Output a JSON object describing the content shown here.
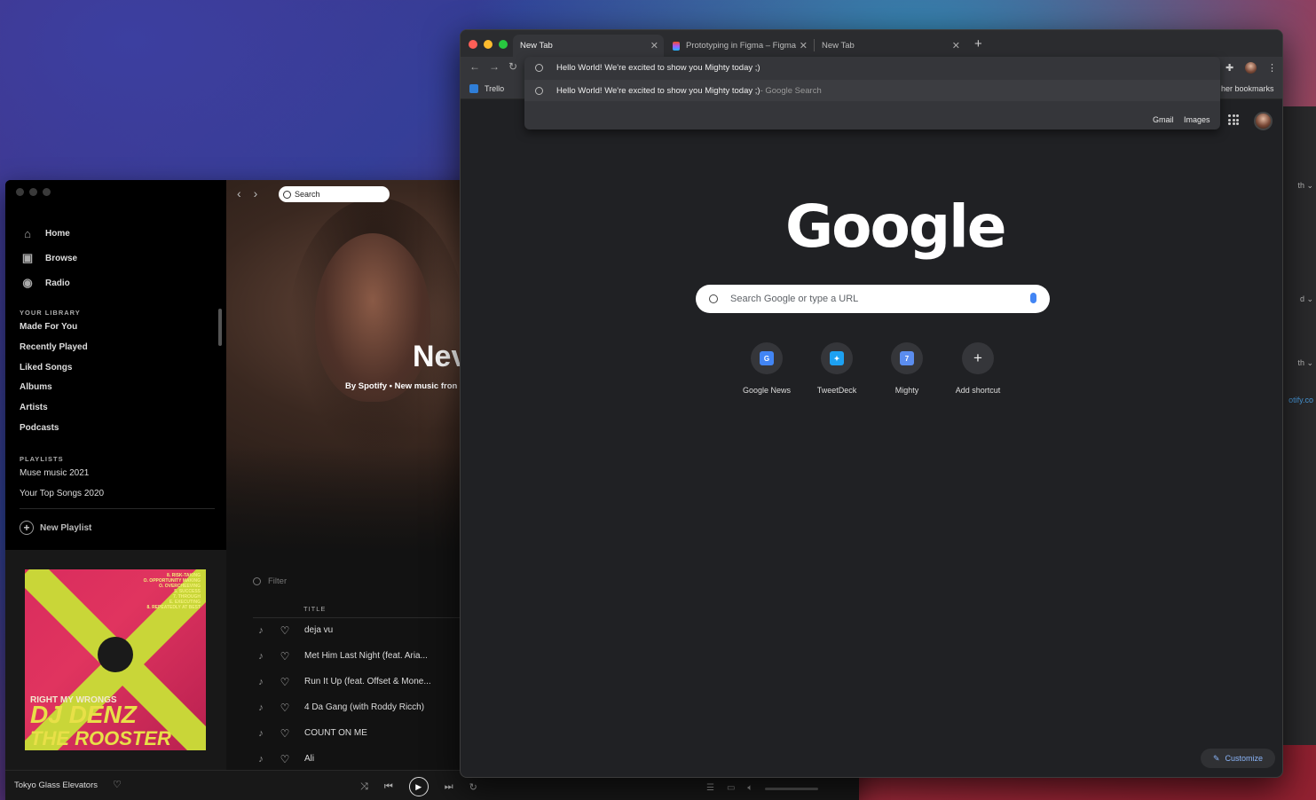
{
  "spotify": {
    "search_placeholder": "Search",
    "nav": [
      {
        "label": "Home",
        "icon": "home-icon",
        "glyph": "⌂"
      },
      {
        "label": "Browse",
        "icon": "browse-icon",
        "glyph": "▣"
      },
      {
        "label": "Radio",
        "icon": "radio-icon",
        "glyph": "◉"
      }
    ],
    "library_heading": "YOUR LIBRARY",
    "library": [
      "Made For You",
      "Recently Played",
      "Liked Songs",
      "Albums",
      "Artists",
      "Podcasts"
    ],
    "playlists_heading": "PLAYLISTS",
    "playlists": [
      "Muse music 2021",
      "Your Top Songs 2020"
    ],
    "new_playlist": "New Playlist",
    "album": {
      "list_lines": [
        "8. RISK-TAKING",
        "O. OPPORTUNITY MAKING",
        "O. OVERCHEEVING",
        "5. SUCCESS",
        "7. THROUGH",
        "E. EXECUTING",
        "8. REPEATEDLY AT BEST"
      ],
      "line1": "RIGHT MY WRONGS",
      "line2": "DJ DENZ",
      "line3": "THE ROOSTER"
    },
    "hero": {
      "title": "Nev",
      "subtitle": "By Spotify • New music fron"
    },
    "filter_placeholder": "Filter",
    "col_title": "TITLE",
    "tracks": [
      "deja vu",
      "Met Him Last Night (feat. Aria...",
      "Run It Up (feat. Offset & Mone...",
      "4 Da Gang (with Roddy Ricch)",
      "COUNT ON ME",
      "Ali"
    ],
    "now_playing": "Tokyo Glass Elevators"
  },
  "chrome": {
    "tabs": [
      {
        "label": "New Tab",
        "active": true
      },
      {
        "label": "Prototyping in Figma – Figma",
        "active": false
      },
      {
        "label": "New Tab",
        "active": false
      }
    ],
    "omnibox": {
      "input": "Hello World! We're excited to show you Mighty today ;)",
      "suggestion": "Hello World! We're excited to show you Mighty today ;)",
      "suggestion_hint": " - Google Search"
    },
    "bookmarks": {
      "trello": "Trello",
      "other": "her bookmarks"
    },
    "gbar": {
      "gmail": "Gmail",
      "images": "Images"
    },
    "search_placeholder": "Search Google or type a URL",
    "logo": "Google",
    "shortcuts": [
      {
        "label": "Google News",
        "icon": "google-news-icon",
        "glyph": "G",
        "color": "#4285f4"
      },
      {
        "label": "TweetDeck",
        "icon": "tweetdeck-icon",
        "glyph": "✦",
        "color": "#1da1f2"
      },
      {
        "label": "Mighty",
        "icon": "mighty-icon",
        "glyph": "7",
        "color": "#5b8def"
      },
      {
        "label": "Add shortcut",
        "icon": "plus-icon",
        "glyph": "+",
        "color": ""
      }
    ],
    "customize": "Customize"
  },
  "background_window": {
    "fragments": [
      "th ⌄",
      "d ⌄",
      "th ⌄",
      "otify.co"
    ]
  }
}
